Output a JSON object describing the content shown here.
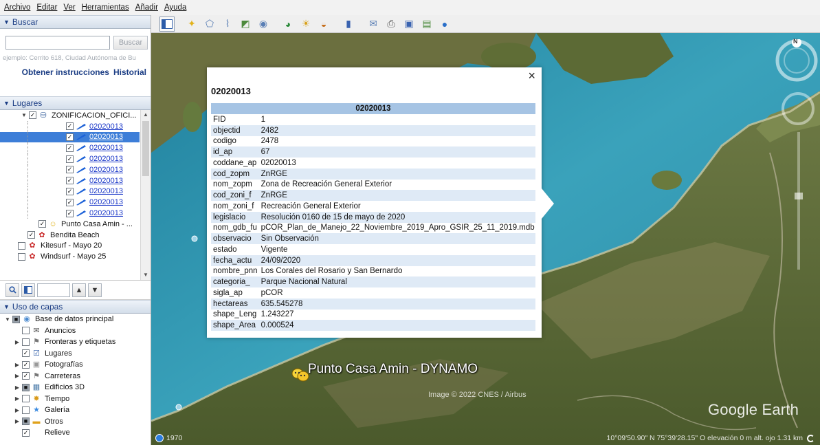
{
  "menu": [
    "Archivo",
    "Editar",
    "Ver",
    "Herramientas",
    "Añadir",
    "Ayuda"
  ],
  "search": {
    "header": "Buscar",
    "button": "Buscar",
    "hint": "ejemplo: Cerrito 618, Ciudad Autónoma de Bu",
    "directions_link": "Obtener instrucciones",
    "history_link": "Historial"
  },
  "places": {
    "header": "Lugares",
    "folder": "ZONIFICACION_OFICI...",
    "items": [
      "02020013",
      "02020013",
      "02020013",
      "02020013",
      "02020013",
      "02020013",
      "02020013",
      "02020013",
      "02020013"
    ],
    "selected_index": 1,
    "extra": [
      "Punto Casa Amin - ...",
      "Bendita Beach",
      "Kitesurf - Mayo 20",
      "Windsurf - Mayo 25"
    ]
  },
  "layers": {
    "header": "Uso de capas",
    "root": "Base de datos principal",
    "items": [
      "Anuncios",
      "Fronteras y etiquetas",
      "Lugares",
      "Fotografías",
      "Carreteras",
      "Edificios 3D",
      "Tiempo",
      "Galería",
      "Otros",
      "Relieve"
    ]
  },
  "popup": {
    "title": "02020013",
    "table_header": "02020013",
    "close": "×",
    "rows": [
      {
        "k": "FID",
        "v": "1"
      },
      {
        "k": "objectid",
        "v": "2482"
      },
      {
        "k": "codigo",
        "v": "2478"
      },
      {
        "k": "id_ap",
        "v": "67"
      },
      {
        "k": "coddane_ap",
        "v": "02020013"
      },
      {
        "k": "cod_zopm",
        "v": "ZnRGE"
      },
      {
        "k": "nom_zopm",
        "v": "Zona de Recreación General Exterior"
      },
      {
        "k": "cod_zoni_f",
        "v": "ZnRGE"
      },
      {
        "k": "nom_zoni_f",
        "v": "Recreación General Exterior"
      },
      {
        "k": "legislacio",
        "v": "Resolución 0160 de 15 de mayo de 2020"
      },
      {
        "k": "nom_gdb_fu",
        "v": "pCOR_Plan_de_Manejo_22_Noviembre_2019_Apro_GSIR_25_11_2019.mdb"
      },
      {
        "k": "observacio",
        "v": "Sin Observación"
      },
      {
        "k": "estado",
        "v": "Vigente"
      },
      {
        "k": "fecha_actu",
        "v": "24/09/2020"
      },
      {
        "k": "nombre_pnn",
        "v": "Los Corales del Rosario y San Bernardo"
      },
      {
        "k": "categoria_",
        "v": "Parque Nacional Natural"
      },
      {
        "k": "sigla_ap",
        "v": "pCOR"
      },
      {
        "k": "hectareas",
        "v": "635.545278"
      },
      {
        "k": "shape_Leng",
        "v": "1.243227"
      },
      {
        "k": "shape_Area",
        "v": "0.000524"
      }
    ]
  },
  "map": {
    "placemark": "Punto Casa Amin - DYNAMO",
    "credit": "Image © 2022 CNES / Airbus",
    "logo": "Google Earth",
    "compass_n": "N",
    "year": "1970",
    "coords": "10°09'50.90\" N   75°39'28.15\" O  elevación    0 m   alt. ojo  1.31 km"
  }
}
